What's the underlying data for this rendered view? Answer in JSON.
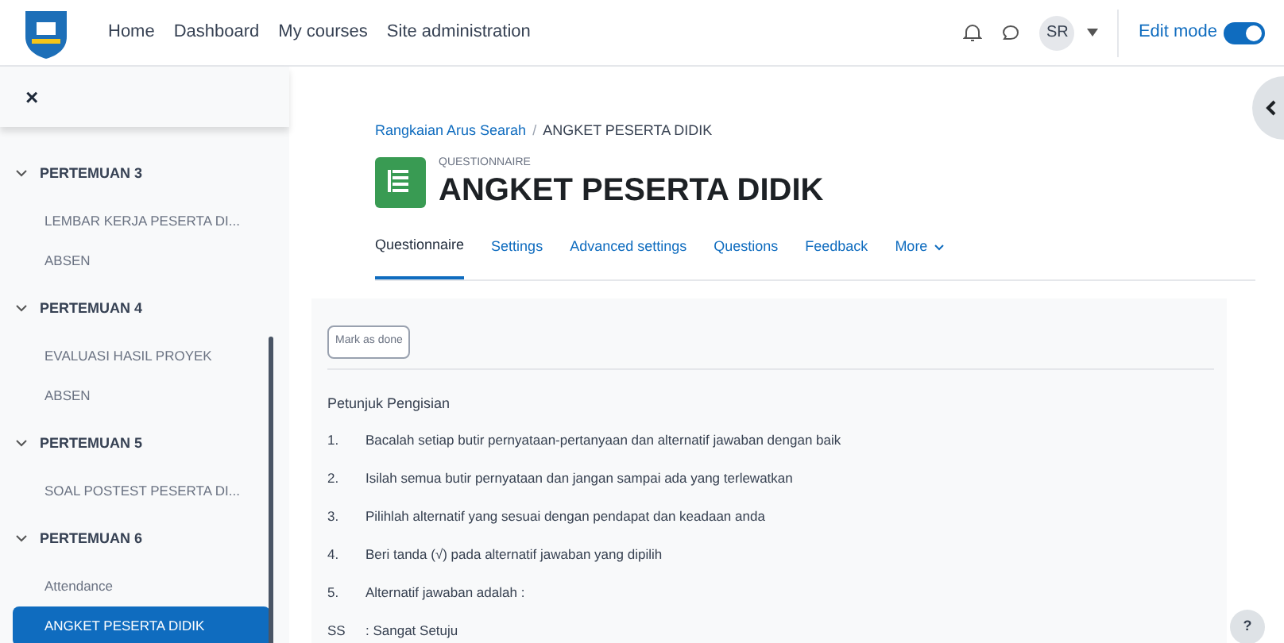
{
  "nav": {
    "links": [
      "Home",
      "Dashboard",
      "My courses",
      "Site administration"
    ],
    "avatar": "SR",
    "edit_mode": {
      "label": "Edit mode",
      "on": true
    }
  },
  "sidebar": {
    "close": "×",
    "sections": [
      {
        "title": "PERTEMUAN 3",
        "expanded": true,
        "items": [
          {
            "label": "LEMBAR KERJA PESERTA DI...",
            "selected": false
          },
          {
            "label": "ABSEN",
            "selected": false
          }
        ]
      },
      {
        "title": "PERTEMUAN 4",
        "expanded": true,
        "items": [
          {
            "label": "EVALUASI HASIL PROYEK",
            "selected": false
          },
          {
            "label": "ABSEN",
            "selected": false
          }
        ]
      },
      {
        "title": "PERTEMUAN 5",
        "expanded": true,
        "items": [
          {
            "label": "SOAL POSTEST PESERTA DI...",
            "selected": false
          }
        ]
      },
      {
        "title": "PERTEMUAN 6",
        "expanded": true,
        "items": [
          {
            "label": "Attendance",
            "selected": false
          },
          {
            "label": "ANGKET PESERTA DIDIK",
            "selected": true
          }
        ]
      }
    ]
  },
  "breadcrumb": [
    "Rangkaian Arus Searah",
    "/",
    "ANGKET PESERTA DIDIK"
  ],
  "activity": {
    "type": "QUESTIONNAIRE",
    "title": "ANGKET PESERTA DIDIK"
  },
  "tabs": [
    {
      "label": "Questionnaire",
      "selected": true
    },
    {
      "label": "Settings",
      "selected": false
    },
    {
      "label": "Advanced settings",
      "selected": false
    },
    {
      "label": "Questions",
      "selected": false
    },
    {
      "label": "Feedback",
      "selected": false
    },
    {
      "label": "More",
      "selected": false
    }
  ],
  "mark_done": "Mark as done",
  "instructions": {
    "heading": "Petunjuk Pengisian",
    "items": [
      {
        "number": "1.",
        "text": "Bacalah setiap butir pernyataan-pertanyaan dan alternatif jawaban dengan baik"
      },
      {
        "number": "2.",
        "text": "Isilah semua butir pernyataan dan jangan sampai ada yang terlewatkan"
      },
      {
        "number": "3.",
        "text": "Pilihlah alternatif yang sesuai dengan pendapat dan keadaan anda"
      },
      {
        "number": "4.",
        "text": "Beri tanda (√) pada alternatif jawaban yang dipilih"
      },
      {
        "number": "5.",
        "text": "Alternatif jawaban adalah :"
      },
      {
        "number": "SS",
        "text": ": Sangat Setuju"
      }
    ]
  },
  "help": "?"
}
